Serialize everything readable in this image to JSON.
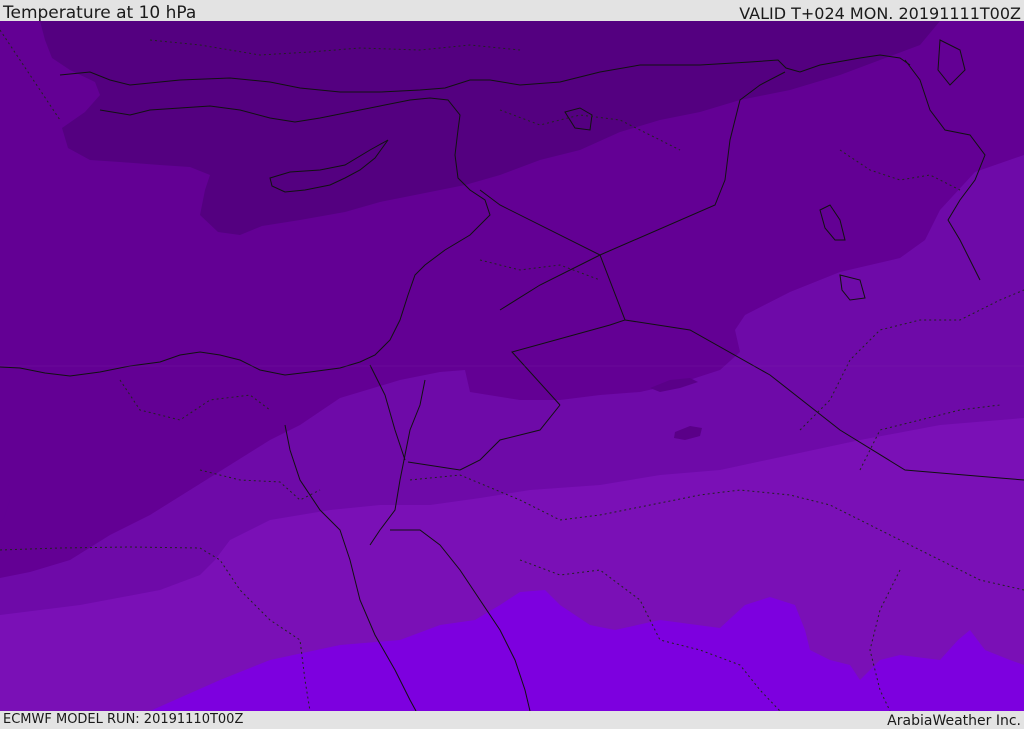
{
  "header": {
    "title": "Temperature at 10 hPa",
    "valid": "VALID T+024 MON. 20191111T00Z"
  },
  "footer": {
    "model_run": "ECMWF MODEL RUN: 20191110T00Z",
    "brand": "ArabiaWeather Inc."
  },
  "colors": {
    "band_coldest": "#540080",
    "band_cold": "#630094",
    "band_mid": "#6e0aa8",
    "band_warm": "#7a10b6",
    "band_warmest": "#7d00df",
    "lines": "#111111",
    "background": "#e3e3e3"
  }
}
